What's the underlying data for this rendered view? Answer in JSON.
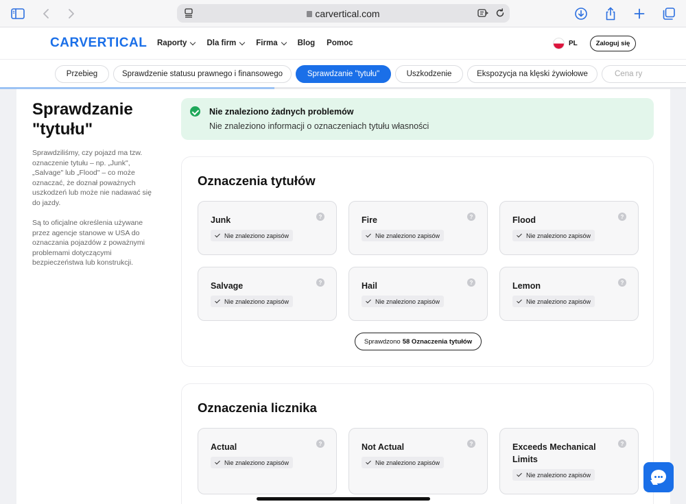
{
  "browser": {
    "url": "carvertical.com"
  },
  "header": {
    "logo": "CARVERTICAL",
    "nav": [
      "Raporty",
      "Dla firm",
      "Firma",
      "Blog",
      "Pomoc"
    ],
    "language": "PL",
    "login": "Zaloguj się"
  },
  "tabs": [
    "Przebieg",
    "Sprawdzenie statusu prawnego i finansowego",
    "Sprawdzanie \"tytułu\"",
    "Uszkodzenie",
    "Ekspozycja na klęski żywiołowe",
    "Cena ry"
  ],
  "active_tab": "Sprawdzanie \"tytułu\"",
  "scroll_progress_percent": 40,
  "sidebar": {
    "title": "Sprawdzanie \"tytułu\"",
    "paragraph1": "Sprawdziliśmy, czy pojazd ma tzw. oznaczenie tytułu – np. „Junk\", „Salvage\" lub „Flood\" – co może oznaczać, że doznał poważnych uszkodzeń lub może nie nadawać się do jazdy.",
    "paragraph2": "Są to oficjalne określenia używane przez agencje stanowe w USA do oznaczania pojazdów z poważnymi problemami dotyczącymi bezpieczeństwa lub konstrukcji."
  },
  "alert": {
    "title": "Nie znaleziono żadnych problemów",
    "subtitle": "Nie znaleziono informacji o oznaczeniach tytułu własności"
  },
  "title_section": {
    "heading": "Oznaczenia tytułów",
    "cards": [
      {
        "title": "Junk",
        "status": "Nie znaleziono zapisów"
      },
      {
        "title": "Fire",
        "status": "Nie znaleziono zapisów"
      },
      {
        "title": "Flood",
        "status": "Nie znaleziono zapisów"
      },
      {
        "title": "Salvage",
        "status": "Nie znaleziono zapisów"
      },
      {
        "title": "Hail",
        "status": "Nie znaleziono zapisów"
      },
      {
        "title": "Lemon",
        "status": "Nie znaleziono zapisów"
      }
    ],
    "checked_prefix": "Sprawdzono",
    "checked_bold": "58 Oznaczenia tytułów"
  },
  "odometer_section": {
    "heading": "Oznaczenia licznika",
    "cards": [
      {
        "title": "Actual",
        "status": "Nie znaleziono zapisów"
      },
      {
        "title": "Not Actual",
        "status": "Nie znaleziono zapisów"
      },
      {
        "title": "Exceeds Mechanical Limits",
        "status": "Nie znaleziono zapisów"
      }
    ]
  },
  "help_glyph": "?",
  "colors": {
    "brand": "#1a6fe8",
    "success_bg": "#e3f6eb",
    "success_icon": "#1fa85a"
  }
}
